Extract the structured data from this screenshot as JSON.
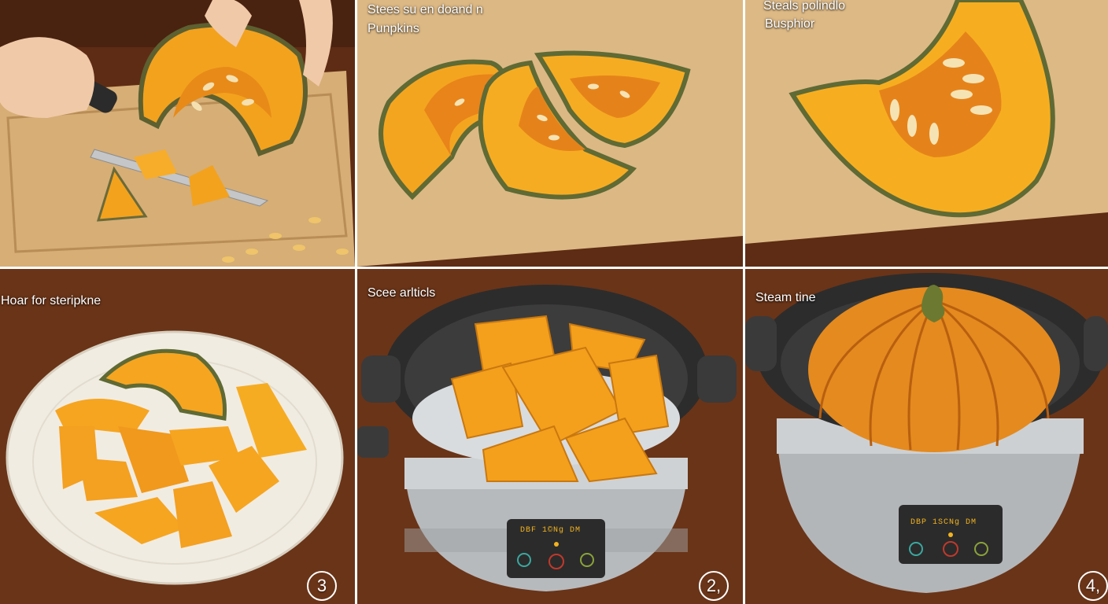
{
  "panels": [
    {
      "id": "cut",
      "captions": []
    },
    {
      "id": "slices",
      "captions": [
        "Stees su en doand n",
        "Punpkins"
      ]
    },
    {
      "id": "wedge",
      "captions": [
        "Steals polindlo",
        "Busphior"
      ]
    },
    {
      "id": "plate",
      "captions": [
        "Hoar for steripkne"
      ],
      "step": "3"
    },
    {
      "id": "steamer",
      "captions": [
        "Scee arlticls"
      ],
      "step": "2,",
      "display": "DBF  1©Ng  DM"
    },
    {
      "id": "cooker",
      "captions": [
        "Steam tine"
      ],
      "step": "4,",
      "display": "DBP  1SCNg  DM"
    }
  ],
  "colors": {
    "pumpkin": "#f6a21d",
    "pumpkin_dark": "#e07a12",
    "rind": "#6b6a3a",
    "board": "#d8b27c",
    "wood_table": "#6b3418",
    "steel": "#b9bcc0",
    "lcd_text": "#f2b320"
  }
}
